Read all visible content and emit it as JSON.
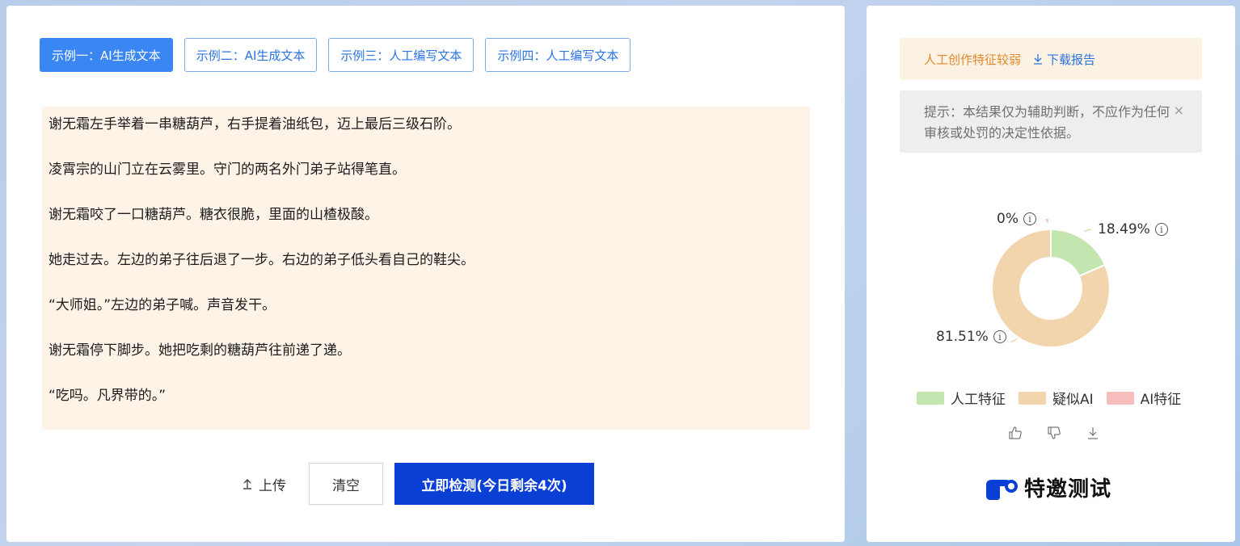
{
  "tabs": [
    {
      "label": "示例一：AI生成文本"
    },
    {
      "label": "示例二：AI生成文本"
    },
    {
      "label": "示例三：人工编写文本"
    },
    {
      "label": "示例四：人工编写文本"
    }
  ],
  "text": {
    "paragraphs": [
      "谢无霜左手举着一串糖葫芦，右手提着油纸包，迈上最后三级石阶。",
      "凌霄宗的山门立在云雾里。守门的两名外门弟子站得笔直。",
      "谢无霜咬了一口糖葫芦。糖衣很脆，里面的山楂极酸。",
      "她走过去。左边的弟子往后退了一步。右边的弟子低头看自己的鞋尖。",
      "“大师姐。”左边的弟子喊。声音发干。",
      "谢无霜停下脚步。她把吃剩的糖葫芦往前递了递。",
      "“吃吗。凡界带的。”"
    ]
  },
  "actions": {
    "upload_label": "上传",
    "clear_label": "清空",
    "detect_label": "立即检测(今日剩余4次)"
  },
  "result": {
    "summary": "人工创作特征较弱",
    "download_label": "下载报告",
    "tip": "提示：本结果仅为辅助判断，不应作为任何审核或处罚的决定性依据。",
    "tip_close": "×"
  },
  "chart_data": {
    "type": "pie",
    "categories": [
      "人工特征",
      "疑似AI",
      "AI特征"
    ],
    "values": [
      18.49,
      81.51,
      0
    ],
    "labels": [
      "18.49%",
      "81.51%",
      "0%"
    ],
    "colors": [
      "#c3e6b0",
      "#f3d5ad",
      "#f7bcbc"
    ]
  },
  "legend": [
    {
      "label": "人工特征",
      "color": "#c3e6b0"
    },
    {
      "label": "疑似AI",
      "color": "#f3d5ad"
    },
    {
      "label": "AI特征",
      "color": "#f7bcbc"
    }
  ],
  "icons": {
    "upload": "upload-icon",
    "download": "download-icon",
    "like": "thumbs-up-icon",
    "dislike": "thumbs-down-icon",
    "save": "download-icon",
    "info": "info-icon"
  },
  "brand": {
    "label": "特邀测试",
    "color": "#0a3fd6"
  }
}
